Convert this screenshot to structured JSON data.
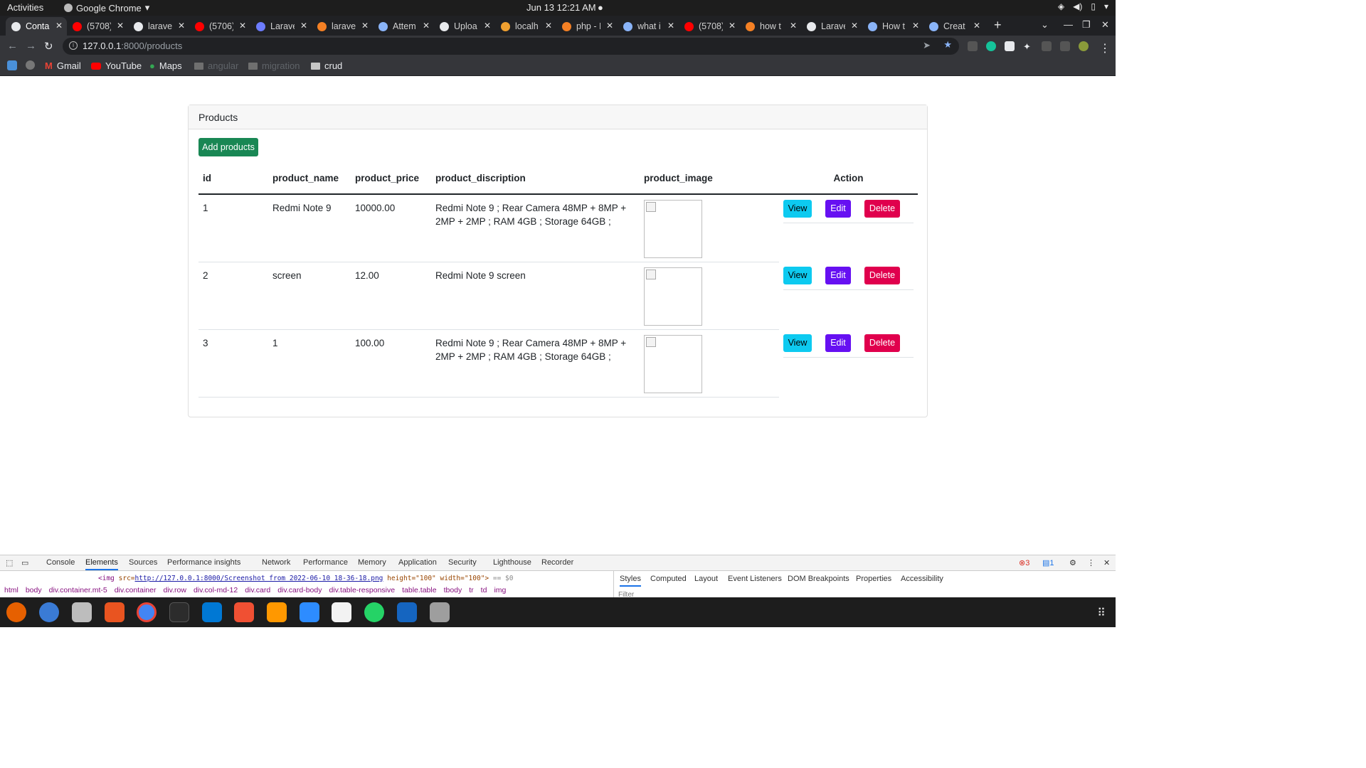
{
  "system": {
    "activities": "Activities",
    "app_name": "Google Chrome",
    "clock": "Jun 13  12:21 AM"
  },
  "browser": {
    "tabs": [
      {
        "title": "Conta",
        "color": "#e8eaed"
      },
      {
        "title": "(5708)",
        "color": "#ff0000"
      },
      {
        "title": "larave",
        "color": "#e8eaed"
      },
      {
        "title": "(5706)",
        "color": "#ff0000"
      },
      {
        "title": "Larave",
        "color": "#6c7cff"
      },
      {
        "title": "larave",
        "color": "#f48024"
      },
      {
        "title": "Attem",
        "color": "#8ab4f8"
      },
      {
        "title": "Uploa",
        "color": "#e8eaed"
      },
      {
        "title": "localh",
        "color": "#f0a030"
      },
      {
        "title": "php - I",
        "color": "#f48024"
      },
      {
        "title": "what i",
        "color": "#8ab4f8"
      },
      {
        "title": "(5708)",
        "color": "#ff0000"
      },
      {
        "title": "how t",
        "color": "#f48024"
      },
      {
        "title": "Larave",
        "color": "#e8eaed"
      },
      {
        "title": "How t",
        "color": "#8ab4f8"
      },
      {
        "title": "Creat",
        "color": "#8ab4f8"
      }
    ],
    "url_host": "127.0.0.1",
    "url_path": ":8000/products",
    "bookmarks": [
      "Gmail",
      "YouTube",
      "Maps",
      "angular",
      "migration",
      "crud"
    ]
  },
  "page": {
    "card_title": "Products",
    "add_button": "Add products",
    "columns": [
      "id",
      "product_name",
      "product_price",
      "product_discription",
      "product_image",
      "Action"
    ],
    "rows": [
      {
        "id": "1",
        "name": "Redmi Note 9",
        "price": "10000.00",
        "description": "Redmi Note 9 ; Rear Camera 48MP + 8MP + 2MP + 2MP ; RAM 4GB ; Storage 64GB ;"
      },
      {
        "id": "2",
        "name": "screen",
        "price": "12.00",
        "description": "Redmi Note 9 screen"
      },
      {
        "id": "3",
        "name": "1",
        "price": "100.00",
        "description": "Redmi Note 9 ; Rear Camera 48MP + 8MP + 2MP + 2MP ; RAM 4GB ; Storage 64GB ;"
      }
    ],
    "actions": {
      "view": "View",
      "edit": "Edit",
      "delete": "Delete"
    }
  },
  "devtools": {
    "tabs": [
      "Console",
      "Elements",
      "Sources",
      "Performance insights",
      "Network",
      "Performance",
      "Memory",
      "Application",
      "Security",
      "Lighthouse",
      "Recorder"
    ],
    "selected_tab": "Elements",
    "code_tag": "<img",
    "code_src_attr": "src=",
    "code_src": "http://127.0.0.1:8000/Screenshot from 2022-06-10 18-36-18.png",
    "code_height": "height=\"100\"",
    "code_width": "width=\"100\">",
    "code_eq": "== $0",
    "crumbs": [
      "html",
      "body",
      "div.container.mt-5",
      "div.container",
      "div.row",
      "div.col-md-12",
      "div.card",
      "div.card-body",
      "div.table-responsive",
      "table.table",
      "tbody",
      "tr",
      "td",
      "img"
    ],
    "side_tabs": [
      "Styles",
      "Computed",
      "Layout",
      "Event Listeners",
      "DOM Breakpoints",
      "Properties",
      "Accessibility"
    ],
    "filter": "Filter",
    "errors": "3",
    "messages": "1"
  }
}
